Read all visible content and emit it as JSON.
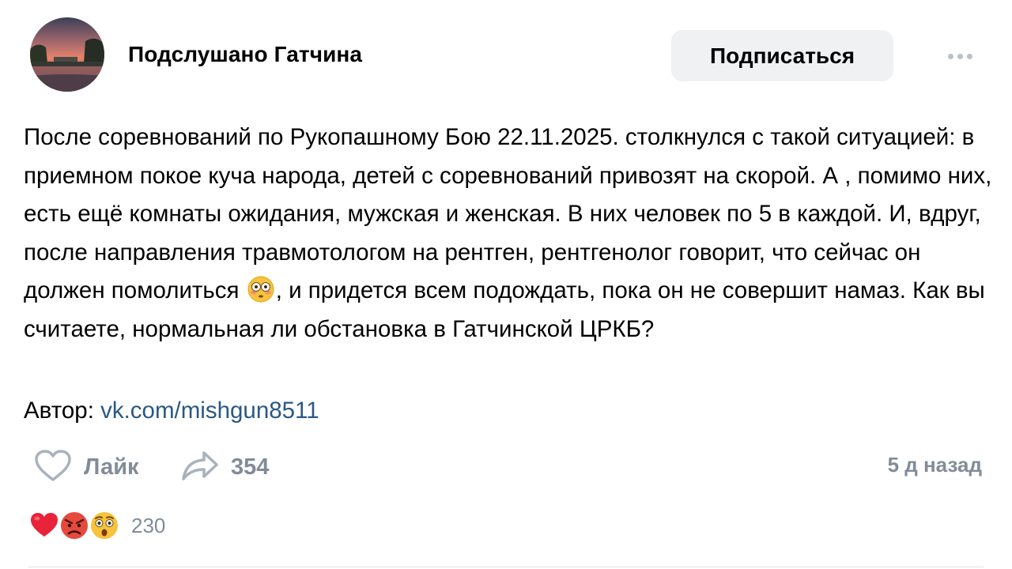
{
  "group": {
    "name": "Подслушано Гатчина",
    "subscribe_label": "Подписаться"
  },
  "post": {
    "text_before_emoji": "После соревнований по Рукопашному Бою 22.11.2025. столкнулся с такой ситуацией: в приемном покое куча народа, детей с соревнований привозят на скорой. А , помимо них, есть ещё комнаты ожидания, мужская и женская. В них человек по 5 в каждой. И, вдруг, после направления травмотологом на рентген, рентгенолог говорит, что сейчас он должен помолиться",
    "text_after_emoji": ", и придется всем подождать, пока он не совершит намаз. Как вы считаете, нормальная ли обстановка в Гатчинской ЦРКБ?",
    "inline_emoji": "flushed-face-emoji",
    "author_prefix": "Автор:",
    "author_link": "vk.com/mishgun8511"
  },
  "actions": {
    "like_label": "Лайк",
    "share_count": "354",
    "timestamp": "5 д назад"
  },
  "reactions": {
    "icons": [
      "heart-emoji",
      "angry-face-emoji",
      "astonished-face-emoji"
    ],
    "count": "230"
  },
  "colors": {
    "link": "#2a5885",
    "secondary_text": "#818c99",
    "button_bg": "#eff1f3"
  }
}
